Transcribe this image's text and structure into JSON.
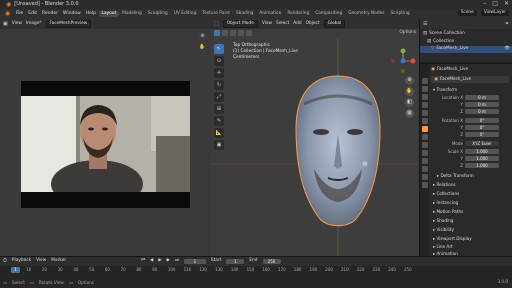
{
  "window": {
    "title": "[Unsaved] - Blender 3.0.0",
    "controls": [
      "–",
      "□",
      "✕"
    ]
  },
  "menu": {
    "items": [
      "File",
      "Edit",
      "Render",
      "Window",
      "Help"
    ],
    "workspaces": [
      "Layout",
      "Modeling",
      "Sculpting",
      "UV Editing",
      "Texture Paint",
      "Shading",
      "Animation",
      "Rendering",
      "Compositing",
      "Geometry Nodes",
      "Scripting"
    ],
    "active_workspace": "Layout",
    "scene": "Scene",
    "view_layer": "ViewLayer"
  },
  "image_editor": {
    "view": "View",
    "image_menu": "Image*",
    "image_name": "FaceMeshPreview"
  },
  "viewport": {
    "mode": "Object Mode",
    "menus": [
      "View",
      "Select",
      "Add",
      "Object"
    ],
    "orientation": "Global",
    "info_line1": "Top Orthographic",
    "info_line2": "(1) Collection | FaceMesh_Live",
    "info_line3": "Centimeters",
    "options": "Options"
  },
  "outliner": {
    "header": "Scene Collection",
    "rows": [
      {
        "label": "Collection"
      },
      {
        "label": "FaceMesh_Live"
      }
    ]
  },
  "properties": {
    "object_name": "FaceMesh_Live",
    "object_field": "FaceMesh_Live",
    "transform_title": "Transform",
    "location_label": "Location X",
    "location": [
      "0 m",
      "0 m",
      "0 m"
    ],
    "rotation_label": "Rotation X",
    "rotation": [
      "0°",
      "0°",
      "0°"
    ],
    "mode_label": "Mode",
    "mode_value": "XYZ Euler",
    "scale_label": "Scale X",
    "scale": [
      "1.000",
      "1.000",
      "1.000"
    ],
    "y_label": "Y",
    "z_label": "Z",
    "sections": [
      "Delta Transform",
      "Relations",
      "Collections",
      "Instancing",
      "Motion Paths",
      "Shading",
      "Visibility",
      "Viewport Display",
      "Line Art",
      "Animation"
    ]
  },
  "timeline": {
    "menus": [
      "Playback",
      "View",
      "Marker"
    ],
    "current_frame": "1",
    "start_label": "Start",
    "start": "1",
    "end_label": "End",
    "end": "250",
    "ticks": [
      "1",
      "10",
      "20",
      "30",
      "40",
      "50",
      "60",
      "70",
      "80",
      "90",
      "100",
      "110",
      "120",
      "130",
      "140",
      "150",
      "160",
      "170",
      "180",
      "190",
      "200",
      "210",
      "220",
      "230",
      "240",
      "250"
    ]
  },
  "status": {
    "items": [
      "Select",
      "Rotate View",
      "Options"
    ],
    "version": "3.0.0"
  },
  "colors": {
    "accent": "#4772b3",
    "active_object": "#ff9a3c",
    "blender_orange": "#f5792a"
  }
}
